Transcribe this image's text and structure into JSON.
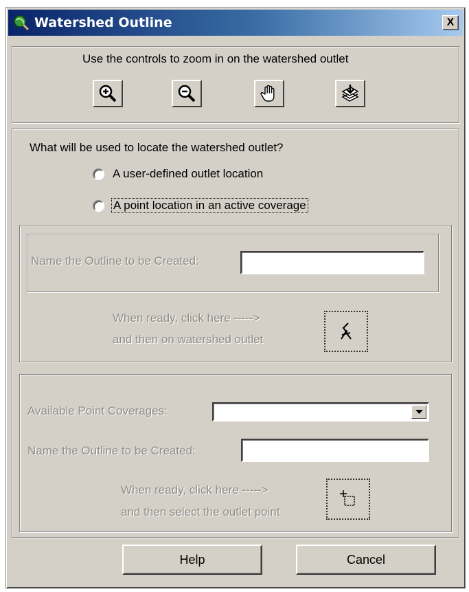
{
  "window": {
    "title": "Watershed Outline",
    "close_label": "X"
  },
  "zoom_panel": {
    "instruction": "Use the controls to zoom in on the watershed outlet",
    "tools": [
      "zoom-in-icon",
      "zoom-out-icon",
      "pan-hand-icon",
      "full-extent-icon"
    ]
  },
  "locate": {
    "question": "What will be used to locate the watershed outlet?",
    "options": [
      {
        "label": "A user-defined outlet location",
        "selected": false
      },
      {
        "label": "A point location in an active coverage",
        "selected": false,
        "focused": true
      }
    ]
  },
  "user_defined": {
    "name_label": "Name the Outline to be Created:",
    "name_value": "",
    "ready_line1": "When ready, click here ----->",
    "ready_line2": "and then on watershed outlet",
    "pick_icon": "pick-outlet-icon"
  },
  "coverage": {
    "coverage_label": "Available Point Coverages:",
    "coverage_value": "",
    "name_label": "Name the Outline to be Created:",
    "name_value": "",
    "ready_line1": "When ready, click here ----->",
    "ready_line2": "and then select the outlet point",
    "select_icon": "select-point-icon"
  },
  "buttons": {
    "help": "Help",
    "cancel": "Cancel"
  },
  "colors": {
    "face": "#d4d0c8",
    "title_start": "#0a246a",
    "title_end": "#a6caf0",
    "disabled_text": "#8f8c86"
  }
}
